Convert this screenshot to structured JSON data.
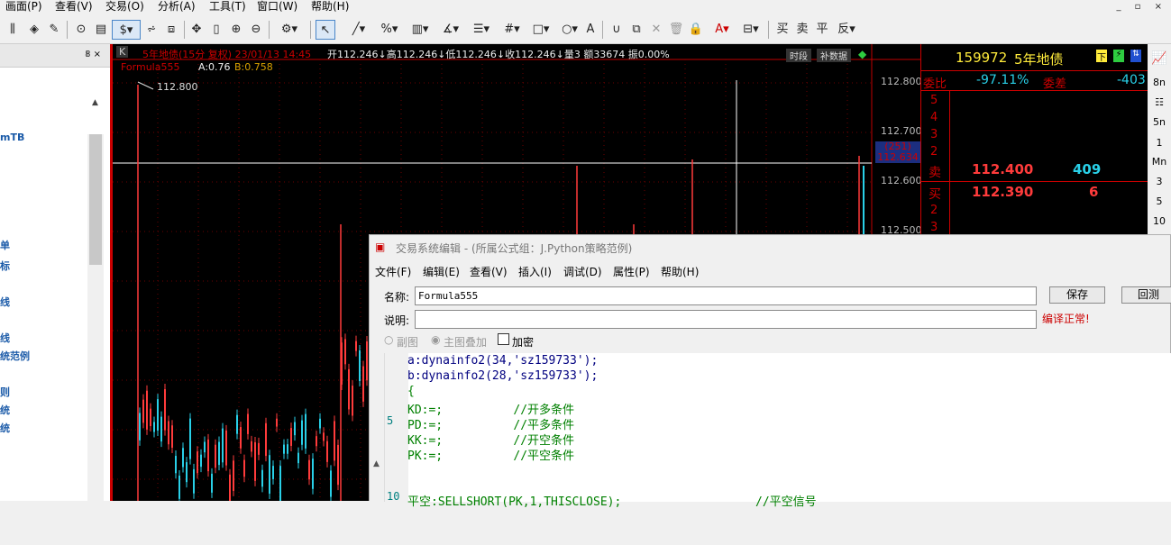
{
  "menu": [
    "画面(P)",
    "查看(V)",
    "交易(O)",
    "分析(A)",
    "工具(T)",
    "窗口(W)",
    "帮助(H)"
  ],
  "window_controls": "_ ▫ ×",
  "toolbar": {
    "dollar": "$",
    "arrow_label": "↖"
  },
  "left_panel": {
    "pin": "𝟠 ×",
    "items": [
      "mTB",
      "单",
      "标",
      "线",
      "线",
      "统范例",
      "则",
      "统",
      "统"
    ]
  },
  "chart": {
    "k_label": "K",
    "title": "5年地债(15分 复权) 23/01/13 14:45",
    "ohlc": "开112.246↓高112.246↓低112.246↓收112.246↓量3 额33674 振0.00%",
    "formula_name": "Formula555",
    "formula_a": "A:0.76",
    "formula_b": "B:0.758",
    "btn_time": "时段",
    "btn_fill": "补数据",
    "peak_label": "112.800",
    "price_ticks": [
      "112.800",
      "112.700",
      "112.600",
      "112.500"
    ],
    "cursor_count": "(251)",
    "cursor_price": "112.634",
    "colors": {
      "up": "#ff3b3b",
      "down": "#29d0e8",
      "axis": "#c00000"
    }
  },
  "quote": {
    "code": "159972",
    "name": "5年地债",
    "webi_label": "委比",
    "webi_value": "-97.11%",
    "weicha_label": "委差",
    "weicha_value": "-403",
    "sell_levels": [
      "5",
      "4",
      "3",
      "2"
    ],
    "sell1_label": "卖",
    "sell1_price": "112.400",
    "sell1_vol": "409",
    "buy1_label": "买",
    "buy1_price": "112.390",
    "buy1_vol": "6",
    "buy_levels": [
      "2",
      "3"
    ]
  },
  "right_bar": [
    "8n",
    "5n",
    "1",
    "Mn",
    "3",
    "5",
    "10"
  ],
  "editor": {
    "title": "交易系统编辑 - (所属公式组：J.Python策略范例)",
    "menu": [
      "文件(F)",
      "编辑(E)",
      "查看(V)",
      "插入(I)",
      "调试(D)",
      "属性(P)",
      "帮助(H)"
    ],
    "name_label": "名称:",
    "name_value": "Formula555",
    "desc_label": "说明:",
    "desc_value": "",
    "save": "保存",
    "test": "回测",
    "compile_status": "编译正常!",
    "radio_sub": "副图",
    "radio_main": "主图叠加",
    "check_encrypt": "加密",
    "line_numbers": [
      "5",
      "10"
    ],
    "code": [
      "a:dynainfo2(34,'sz159733');",
      "b:dynainfo2(28,'sz159733');",
      "{",
      "KD:=;          //开多条件",
      "PD:=;          //平多条件",
      "KK:=;          //开空条件",
      "PK:=;          //平空条件",
      "",
      "",
      "平空:SELLSHORT(PK,1,THISCLOSE);                   //平空信号"
    ]
  }
}
